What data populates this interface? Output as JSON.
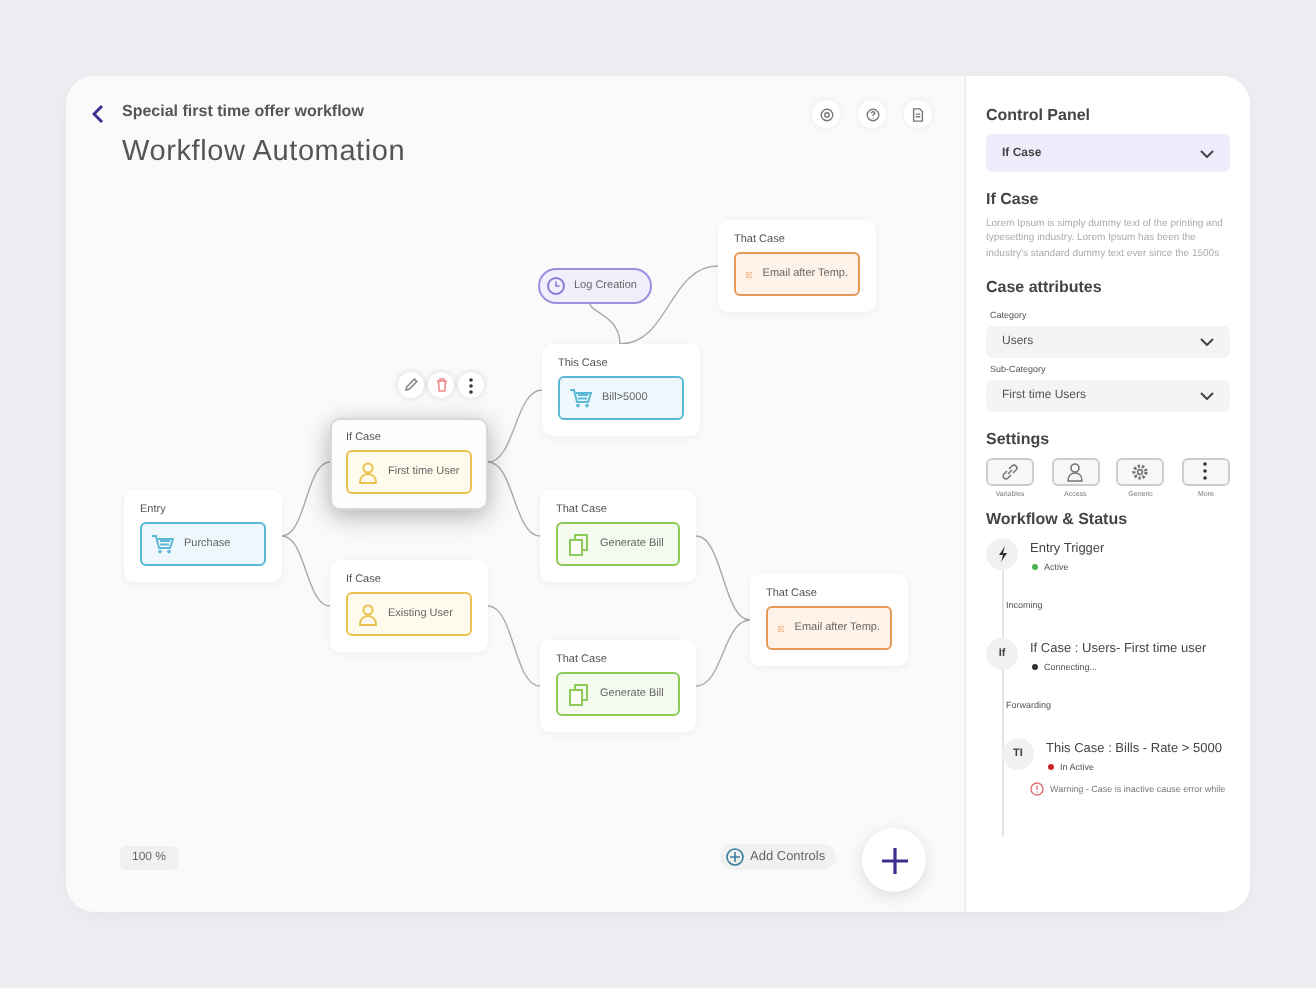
{
  "header": {
    "breadcrumb": "Special first time offer workflow",
    "title": "Workflow Automation"
  },
  "canvas": {
    "nodes": [
      {
        "kind": "cart",
        "header": "Entry",
        "label": "Purchase",
        "selected": false
      },
      {
        "kind": "user",
        "header": "If Case",
        "label": "First time User",
        "selected": true
      },
      {
        "kind": "user",
        "header": "If Case",
        "label": "Existing User",
        "selected": false
      },
      {
        "kind": "cart",
        "header": "This Case",
        "label": "Bill>5000",
        "selected": false
      },
      {
        "kind": "bill",
        "header": "That Case",
        "label": "Generate Bill",
        "selected": false
      },
      {
        "kind": "bill",
        "header": "That Case",
        "label": "Generate Bill",
        "selected": false
      },
      {
        "kind": "mail",
        "header": "That Case",
        "label": "Email after Temp.",
        "selected": false
      },
      {
        "kind": "mail",
        "header": "That Case",
        "label": "Email after Temp.",
        "selected": false
      }
    ],
    "log_pill": "Log Creation",
    "zoom": "100 %",
    "add_controls": "Add Controls"
  },
  "panel": {
    "title": "Control Panel",
    "case_select": "If Case",
    "case_title": "If Case",
    "description": "Lorem Ipsum is simply dummy text of the printing and typesetting industry. Lorem Ipsum has been the industry's standard dummy text ever since the 1500s",
    "attributes_title": "Case attributes",
    "fields": [
      {
        "label": "Category",
        "value": "Users"
      },
      {
        "label": "Sub-Category",
        "value": "First time Users"
      }
    ],
    "settings_title": "Settings",
    "settings": [
      {
        "kind": "link",
        "label": "Variables"
      },
      {
        "kind": "person",
        "label": "Access"
      },
      {
        "kind": "gear",
        "label": "Generic"
      },
      {
        "kind": "more",
        "label": "More"
      }
    ],
    "status_title": "Workflow & Status",
    "status": [
      {
        "kind": "trigger",
        "title": "Entry Trigger",
        "state": "Active",
        "color": "#4caf50",
        "connector": "Incoming"
      },
      {
        "kind": "text",
        "badge": "If",
        "title": "If Case : Users- First time user",
        "state": "Connecting...",
        "color": "#333333",
        "connector": "Forwarding"
      },
      {
        "kind": "text",
        "badge": "TI",
        "title": "This Case : Bills - Rate > 5000",
        "state": "In Active",
        "color": "#c62828",
        "warning": "Warning - Case is inactive cause error while"
      }
    ]
  }
}
